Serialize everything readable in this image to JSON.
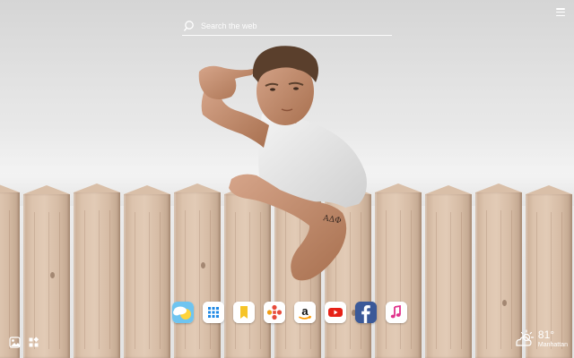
{
  "search": {
    "placeholder": "Search the web"
  },
  "dock": {
    "apps": [
      {
        "name": "Weather",
        "icon": "weather-icon"
      },
      {
        "name": "Apps",
        "icon": "grid-icon"
      },
      {
        "name": "Bookmarks",
        "icon": "bookmark-icon"
      },
      {
        "name": "Games",
        "icon": "gamepad-icon"
      },
      {
        "name": "Amazon",
        "icon": "amazon-icon"
      },
      {
        "name": "YouTube",
        "icon": "youtube-icon"
      },
      {
        "name": "Facebook",
        "icon": "facebook-icon"
      },
      {
        "name": "Music",
        "icon": "music-icon"
      }
    ]
  },
  "weather": {
    "temperature": "81°",
    "location": "Manhattan",
    "condition_icon": "partly-cloudy-icon"
  },
  "tools": [
    {
      "icon": "wallpaper-icon"
    },
    {
      "icon": "widgets-icon"
    }
  ],
  "colors": {
    "youtube": "#e62117",
    "facebook": "#3b5998",
    "bookmark": "#f6c428",
    "music": "#e0338b",
    "grid": "#1e88e5"
  }
}
